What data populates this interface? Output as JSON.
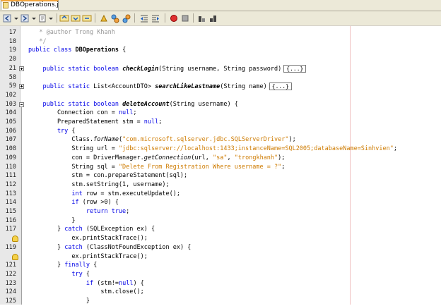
{
  "tab": {
    "label": "DBOperations.java"
  },
  "toolbar": {
    "buttons": [
      "back-icon",
      "forward-icon",
      "last-edit-icon",
      "find-previous-icon",
      "find-next-icon",
      "find-selection-icon",
      "toggle-highlight-icon",
      "previous-bookmark-icon",
      "next-bookmark-icon",
      "toggle-bookmark-icon",
      "shift-left-icon",
      "shift-right-icon",
      "start-macro-icon",
      "stop-macro-icon",
      "comment-icon",
      "uncomment-icon"
    ]
  },
  "editor": {
    "lines": [
      {
        "num": "17",
        "fold": "",
        "hint": false,
        "segments": [
          {
            "t": "   * ",
            "c": "cmt"
          },
          {
            "t": "@author",
            "c": "cmt"
          },
          {
            "t": " Trong Khanh",
            "c": "cmt"
          }
        ]
      },
      {
        "num": "18",
        "fold": "",
        "hint": false,
        "segments": [
          {
            "t": "   */",
            "c": "cmt"
          }
        ]
      },
      {
        "num": "19",
        "fold": "",
        "hint": false,
        "segments": [
          {
            "t": "public class ",
            "c": "kw"
          },
          {
            "t": "DBOperations",
            "c": "b"
          },
          {
            "t": " {",
            "c": ""
          }
        ]
      },
      {
        "num": "20",
        "fold": "",
        "hint": false,
        "segments": []
      },
      {
        "num": "21",
        "fold": "plus",
        "hint": false,
        "segments": [
          {
            "t": "    public static boolean ",
            "c": "kw"
          },
          {
            "t": "checkLogin",
            "c": "b it"
          },
          {
            "t": "(String username, String password)",
            "c": ""
          },
          {
            "t": "{...}",
            "c": "box"
          }
        ]
      },
      {
        "num": "58",
        "fold": "",
        "hint": false,
        "segments": []
      },
      {
        "num": "59",
        "fold": "plus",
        "hint": false,
        "segments": [
          {
            "t": "    public static ",
            "c": "kw"
          },
          {
            "t": "List<AccountDTO> ",
            "c": ""
          },
          {
            "t": "searchLikeLastname",
            "c": "b it"
          },
          {
            "t": "(String name)",
            "c": ""
          },
          {
            "t": "{...}",
            "c": "box"
          }
        ]
      },
      {
        "num": "102",
        "fold": "",
        "hint": false,
        "segments": []
      },
      {
        "num": "103",
        "fold": "minus",
        "hint": false,
        "segments": [
          {
            "t": "    public static boolean ",
            "c": "kw"
          },
          {
            "t": "deleteAccount",
            "c": "b it"
          },
          {
            "t": "(String username) {",
            "c": ""
          }
        ]
      },
      {
        "num": "104",
        "fold": "",
        "hint": false,
        "segments": [
          {
            "t": "        Connection con = ",
            "c": ""
          },
          {
            "t": "null",
            "c": "kw"
          },
          {
            "t": ";",
            "c": ""
          }
        ]
      },
      {
        "num": "105",
        "fold": "",
        "hint": false,
        "segments": [
          {
            "t": "        PreparedStatement stm = ",
            "c": ""
          },
          {
            "t": "null",
            "c": "kw"
          },
          {
            "t": ";",
            "c": ""
          }
        ]
      },
      {
        "num": "106",
        "fold": "",
        "hint": false,
        "segments": [
          {
            "t": "        try",
            "c": "kw"
          },
          {
            "t": " {",
            "c": ""
          }
        ]
      },
      {
        "num": "107",
        "fold": "",
        "hint": false,
        "segments": [
          {
            "t": "            Class.",
            "c": ""
          },
          {
            "t": "forName",
            "c": "it"
          },
          {
            "t": "(",
            "c": ""
          },
          {
            "t": "\"com.microsoft.sqlserver.jdbc.SQLServerDriver\"",
            "c": "str"
          },
          {
            "t": ");",
            "c": ""
          }
        ]
      },
      {
        "num": "108",
        "fold": "",
        "hint": false,
        "segments": [
          {
            "t": "            String url = ",
            "c": ""
          },
          {
            "t": "\"jdbc:sqlserver://localhost:1433;instanceName=SQL2005;databaseName=Sinhvien\"",
            "c": "str"
          },
          {
            "t": ";",
            "c": ""
          }
        ]
      },
      {
        "num": "109",
        "fold": "",
        "hint": false,
        "segments": [
          {
            "t": "            con = DriverManager.",
            "c": ""
          },
          {
            "t": "getConnection",
            "c": "it"
          },
          {
            "t": "(url, ",
            "c": ""
          },
          {
            "t": "\"sa\"",
            "c": "str"
          },
          {
            "t": ", ",
            "c": ""
          },
          {
            "t": "\"trongkhanh\"",
            "c": "str"
          },
          {
            "t": ");",
            "c": ""
          }
        ]
      },
      {
        "num": "110",
        "fold": "",
        "hint": false,
        "segments": [
          {
            "t": "            String sql = ",
            "c": ""
          },
          {
            "t": "\"Delete From Registration Where username = ?\"",
            "c": "str"
          },
          {
            "t": ";",
            "c": ""
          }
        ]
      },
      {
        "num": "111",
        "fold": "",
        "hint": false,
        "segments": [
          {
            "t": "            stm = con.prepareStatement(sql);",
            "c": ""
          }
        ]
      },
      {
        "num": "112",
        "fold": "",
        "hint": false,
        "segments": [
          {
            "t": "            stm.setString(1, username);",
            "c": ""
          }
        ]
      },
      {
        "num": "113",
        "fold": "",
        "hint": false,
        "segments": [
          {
            "t": "            int",
            "c": "kw"
          },
          {
            "t": " row = stm.executeUpdate();",
            "c": ""
          }
        ]
      },
      {
        "num": "114",
        "fold": "",
        "hint": false,
        "segments": [
          {
            "t": "            if",
            "c": "kw"
          },
          {
            "t": " (row >0) {",
            "c": ""
          }
        ]
      },
      {
        "num": "115",
        "fold": "",
        "hint": false,
        "segments": [
          {
            "t": "                return true",
            "c": "kw"
          },
          {
            "t": ";",
            "c": ""
          }
        ]
      },
      {
        "num": "116",
        "fold": "",
        "hint": false,
        "segments": [
          {
            "t": "            }",
            "c": ""
          }
        ]
      },
      {
        "num": "117",
        "fold": "",
        "hint": false,
        "segments": [
          {
            "t": "        } ",
            "c": ""
          },
          {
            "t": "catch",
            "c": "kw"
          },
          {
            "t": " (SQLException ex) {",
            "c": ""
          }
        ]
      },
      {
        "num": "",
        "fold": "",
        "hint": true,
        "segments": [
          {
            "t": "            ex.printStackTrace();",
            "c": ""
          }
        ]
      },
      {
        "num": "119",
        "fold": "",
        "hint": false,
        "segments": [
          {
            "t": "        } ",
            "c": ""
          },
          {
            "t": "catch",
            "c": "kw"
          },
          {
            "t": " (ClassNotFoundException ex) {",
            "c": ""
          }
        ]
      },
      {
        "num": "",
        "fold": "",
        "hint": true,
        "segments": [
          {
            "t": "            ex.printStackTrace();",
            "c": ""
          }
        ]
      },
      {
        "num": "121",
        "fold": "",
        "hint": false,
        "segments": [
          {
            "t": "        } ",
            "c": ""
          },
          {
            "t": "finally",
            "c": "kw"
          },
          {
            "t": " {",
            "c": ""
          }
        ]
      },
      {
        "num": "122",
        "fold": "",
        "hint": false,
        "segments": [
          {
            "t": "            try",
            "c": "kw"
          },
          {
            "t": " {",
            "c": ""
          }
        ]
      },
      {
        "num": "123",
        "fold": "",
        "hint": false,
        "segments": [
          {
            "t": "                if",
            "c": "kw"
          },
          {
            "t": " (stm!=",
            "c": ""
          },
          {
            "t": "null",
            "c": "kw"
          },
          {
            "t": ") {",
            "c": ""
          }
        ]
      },
      {
        "num": "124",
        "fold": "",
        "hint": false,
        "segments": [
          {
            "t": "                    stm.close();",
            "c": ""
          }
        ]
      },
      {
        "num": "125",
        "fold": "",
        "hint": false,
        "segments": [
          {
            "t": "                }",
            "c": ""
          }
        ]
      }
    ]
  }
}
